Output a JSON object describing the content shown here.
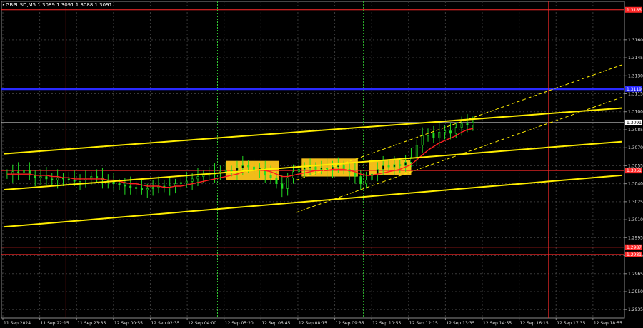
{
  "chart_data": {
    "type": "candlestick",
    "title": "GBPUSD,M5  1.3089 1.3091 1.3088 1.3091",
    "symbol": "GBPUSD",
    "timeframe": "M5",
    "ohlc_readout": {
      "open": 1.3089,
      "high": 1.3091,
      "low": 1.3088,
      "close": 1.3091
    },
    "ylim": [
      1.2928,
      1.3192
    ],
    "y_ticks": [
      1.316,
      1.3145,
      1.313,
      1.3115,
      1.31,
      1.3085,
      1.307,
      1.3055,
      1.304,
      1.3025,
      1.301,
      1.2995,
      1.298,
      1.2965,
      1.295,
      1.2935
    ],
    "y_tick_labels": [
      "1.3160",
      "1.3145",
      "1.3130",
      "1.3115",
      "1.3100",
      "1.3085",
      "1.3070",
      "1.3055",
      "1.3040",
      "1.3025",
      "1.3010",
      "1.2995",
      "1.2980",
      "1.2965",
      "1.2950",
      "1.2935"
    ],
    "x_tick_labels": [
      "11 Sep 2024",
      "11 Sep 22:15",
      "11 Sep 23:35",
      "12 Sep 00:55",
      "12 Sep 02:35",
      "12 Sep 04:00",
      "12 Sep 05:20",
      "12 Sep 06:45",
      "12 Sep 08:15",
      "12 Sep 09:35",
      "12 Sep 10:55",
      "12 Sep 12:15",
      "12 Sep 13:35",
      "12 Sep 14:55",
      "12 Sep 16:15",
      "12 Sep 17:35",
      "12 Sep 18:55"
    ],
    "grid": true,
    "horizontal_levels": [
      {
        "price": 1.3185,
        "label": "1.3185",
        "color": "#ff2a2a"
      },
      {
        "price": 1.3119,
        "label": "1.3119",
        "color": "#2a2aff"
      },
      {
        "price": 1.3091,
        "label": "1.3091",
        "color": "#c0c0c0"
      },
      {
        "price": 1.3051,
        "label": "1.3051",
        "color": "#ff2a2a"
      },
      {
        "price": 1.2987,
        "label": "1.2987",
        "color": "#ff2a2a"
      },
      {
        "price": 1.2981,
        "label": "1.2981",
        "color": "#ff2a2a"
      }
    ],
    "current_price": 1.3091,
    "session_vlines": [
      {
        "index": 11,
        "color": "#ff2a2a",
        "style": "solid"
      },
      {
        "index": 38,
        "color": "#33cc33",
        "style": "dotted"
      },
      {
        "index": 64,
        "color": "#33cc33",
        "style": "dotted"
      },
      {
        "index": 97,
        "color": "#ff2a2a",
        "style": "solid"
      }
    ],
    "trend_channels": [
      {
        "x1": 0,
        "y1": 1.3065,
        "x2": 110,
        "y2": 1.3103,
        "color": "#ffee00",
        "width": 2
      },
      {
        "x1": 0,
        "y1": 1.3035,
        "x2": 110,
        "y2": 1.3075,
        "color": "#ffee00",
        "width": 2
      },
      {
        "x1": 0,
        "y1": 1.3004,
        "x2": 110,
        "y2": 1.3047,
        "color": "#ffee00",
        "width": 2
      },
      {
        "x1": 52,
        "y1": 1.3043,
        "x2": 110,
        "y2": 1.3139,
        "color": "#ffee00",
        "width": 1,
        "dash": true
      },
      {
        "x1": 52,
        "y1": 1.3016,
        "x2": 110,
        "y2": 1.3112,
        "color": "#ffee00",
        "width": 1,
        "dash": true
      }
    ],
    "highlight_boxes": [
      {
        "x_start": 39.5,
        "x_end": 49,
        "y_low": 1.3043,
        "y_high": 1.3059
      },
      {
        "x_start": 53,
        "x_end": 63,
        "y_low": 1.3046,
        "y_high": 1.3061
      },
      {
        "x_start": 65,
        "x_end": 72.5,
        "y_low": 1.3047,
        "y_high": 1.306
      }
    ],
    "close_series": [
      1.3048,
      1.305,
      1.3049,
      1.3051,
      1.3047,
      1.3045,
      1.3046,
      1.3044,
      1.3043,
      1.3045,
      1.3044,
      1.3043,
      1.3042,
      1.3043,
      1.3044,
      1.3046,
      1.3045,
      1.3043,
      1.3042,
      1.304,
      1.3039,
      1.3038,
      1.3037,
      1.3036,
      1.3035,
      1.3036,
      1.3037,
      1.3038,
      1.3037,
      1.3038,
      1.304,
      1.3041,
      1.3042,
      1.3044,
      1.3046,
      1.3047,
      1.3048,
      1.3049,
      1.305,
      1.3051,
      1.305,
      1.3053,
      1.3055,
      1.3054,
      1.3052,
      1.3053,
      1.3047,
      1.3045,
      1.304,
      1.3036,
      1.3045,
      1.305,
      1.3052,
      1.3053,
      1.3054,
      1.3052,
      1.3053,
      1.3051,
      1.3054,
      1.3055,
      1.3052,
      1.305,
      1.3046,
      1.304,
      1.3043,
      1.3048,
      1.3052,
      1.3055,
      1.3054,
      1.3056,
      1.3055,
      1.3058,
      1.3062,
      1.3072,
      1.308,
      1.3082,
      1.3078,
      1.3083,
      1.3084,
      1.3082,
      1.3087,
      1.309,
      1.3089,
      1.3091
    ],
    "moving_average": [
      1.3048,
      1.3048,
      1.3048,
      1.3048,
      1.3048,
      1.3047,
      1.3047,
      1.3047,
      1.3046,
      1.3046,
      1.3045,
      1.3045,
      1.3044,
      1.3044,
      1.3044,
      1.3044,
      1.3044,
      1.3044,
      1.3043,
      1.3043,
      1.3042,
      1.3041,
      1.304,
      1.304,
      1.3039,
      1.3038,
      1.3038,
      1.3038,
      1.3037,
      1.3037,
      1.3038,
      1.3038,
      1.3039,
      1.304,
      1.3041,
      1.3042,
      1.3043,
      1.3044,
      1.3045,
      1.3046,
      1.3047,
      1.3048,
      1.305,
      1.3051,
      1.3051,
      1.3052,
      1.3051,
      1.305,
      1.3048,
      1.3046,
      1.3046,
      1.3047,
      1.3048,
      1.3049,
      1.305,
      1.3051,
      1.3051,
      1.3051,
      1.3052,
      1.3052,
      1.3052,
      1.3051,
      1.305,
      1.3048,
      1.3047,
      1.3047,
      1.3048,
      1.3049,
      1.305,
      1.3051,
      1.3052,
      1.3054,
      1.3056,
      1.306,
      1.3064,
      1.3068,
      1.3071,
      1.3074,
      1.3076,
      1.3078,
      1.308,
      1.3083,
      1.3085,
      1.3086
    ]
  }
}
